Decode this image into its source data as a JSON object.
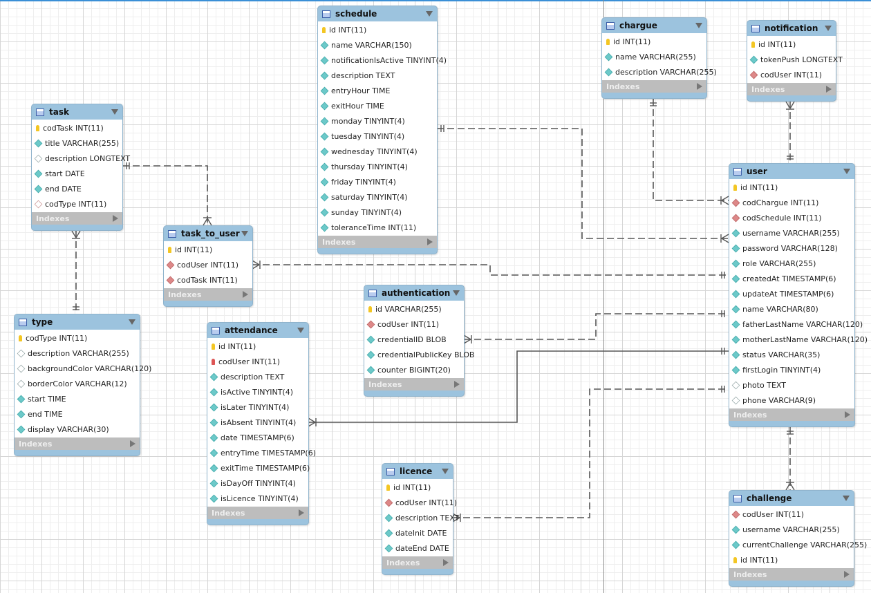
{
  "indexes_label": "Indexes",
  "colors": {
    "header": "#9cc3de",
    "primary_key": "#f3c623",
    "foreign_key": "#d88888",
    "not_null": "#6cc9c9"
  },
  "tables": [
    {
      "name": "schedule",
      "columns": [
        {
          "icon": "key",
          "text": "id INT(11)"
        },
        {
          "icon": "nn",
          "text": "name VARCHAR(150)"
        },
        {
          "icon": "nn",
          "text": "notificationIsActive TINYINT(4)"
        },
        {
          "icon": "nn",
          "text": "description TEXT"
        },
        {
          "icon": "nn",
          "text": "entryHour TIME"
        },
        {
          "icon": "nn",
          "text": "exitHour TIME"
        },
        {
          "icon": "nn",
          "text": "monday TINYINT(4)"
        },
        {
          "icon": "nn",
          "text": "tuesday TINYINT(4)"
        },
        {
          "icon": "nn",
          "text": "wednesday TINYINT(4)"
        },
        {
          "icon": "nn",
          "text": "thursday TINYINT(4)"
        },
        {
          "icon": "nn",
          "text": "friday TINYINT(4)"
        },
        {
          "icon": "nn",
          "text": "saturday TINYINT(4)"
        },
        {
          "icon": "nn",
          "text": "sunday TINYINT(4)"
        },
        {
          "icon": "nn",
          "text": "toleranceTime INT(11)"
        }
      ]
    },
    {
      "name": "task",
      "columns": [
        {
          "icon": "key",
          "text": "codTask INT(11)"
        },
        {
          "icon": "nn",
          "text": "title VARCHAR(255)"
        },
        {
          "icon": "null",
          "text": "description LONGTEXT"
        },
        {
          "icon": "nn",
          "text": "start DATE"
        },
        {
          "icon": "nn",
          "text": "end DATE"
        },
        {
          "icon": "fknull",
          "text": "codType INT(11)"
        }
      ]
    },
    {
      "name": "task_to_user",
      "columns": [
        {
          "icon": "key",
          "text": "id INT(11)"
        },
        {
          "icon": "fk",
          "text": "codUser INT(11)"
        },
        {
          "icon": "fk",
          "text": "codTask INT(11)"
        }
      ]
    },
    {
      "name": "type",
      "columns": [
        {
          "icon": "key",
          "text": "codType INT(11)"
        },
        {
          "icon": "null",
          "text": "description VARCHAR(255)"
        },
        {
          "icon": "null",
          "text": "backgroundColor VARCHAR(120)"
        },
        {
          "icon": "null",
          "text": "borderColor VARCHAR(12)"
        },
        {
          "icon": "nn",
          "text": "start TIME"
        },
        {
          "icon": "nn",
          "text": "end TIME"
        },
        {
          "icon": "nn",
          "text": "display VARCHAR(30)"
        }
      ]
    },
    {
      "name": "attendance",
      "columns": [
        {
          "icon": "key",
          "text": "id INT(11)"
        },
        {
          "icon": "fkkey",
          "text": "codUser INT(11)"
        },
        {
          "icon": "nn",
          "text": "description TEXT"
        },
        {
          "icon": "nn",
          "text": "isActive TINYINT(4)"
        },
        {
          "icon": "nn",
          "text": "isLater TINYINT(4)"
        },
        {
          "icon": "nn",
          "text": "isAbsent TINYINT(4)"
        },
        {
          "icon": "nn",
          "text": "date TIMESTAMP(6)"
        },
        {
          "icon": "nn",
          "text": "entryTime TIMESTAMP(6)"
        },
        {
          "icon": "nn",
          "text": "exitTime TIMESTAMP(6)"
        },
        {
          "icon": "nn",
          "text": "isDayOff TINYINT(4)"
        },
        {
          "icon": "nn",
          "text": "isLicence TINYINT(4)"
        }
      ]
    },
    {
      "name": "authentication",
      "columns": [
        {
          "icon": "key",
          "text": "id VARCHAR(255)"
        },
        {
          "icon": "fk",
          "text": "codUser INT(11)"
        },
        {
          "icon": "nn",
          "text": "credentialID BLOB"
        },
        {
          "icon": "nn",
          "text": "credentialPublicKey BLOB"
        },
        {
          "icon": "nn",
          "text": "counter BIGINT(20)"
        }
      ]
    },
    {
      "name": "licence",
      "columns": [
        {
          "icon": "key",
          "text": "id INT(11)"
        },
        {
          "icon": "fk",
          "text": "codUser INT(11)"
        },
        {
          "icon": "nn",
          "text": "description TEXT"
        },
        {
          "icon": "nn",
          "text": "dateInit DATE"
        },
        {
          "icon": "nn",
          "text": "dateEnd DATE"
        }
      ]
    },
    {
      "name": "chargue",
      "columns": [
        {
          "icon": "key",
          "text": "id INT(11)"
        },
        {
          "icon": "nn",
          "text": "name VARCHAR(255)"
        },
        {
          "icon": "nn",
          "text": "description VARCHAR(255)"
        }
      ]
    },
    {
      "name": "notification",
      "columns": [
        {
          "icon": "key",
          "text": "id INT(11)"
        },
        {
          "icon": "nn",
          "text": "tokenPush LONGTEXT"
        },
        {
          "icon": "fk",
          "text": "codUser INT(11)"
        }
      ]
    },
    {
      "name": "user",
      "columns": [
        {
          "icon": "key",
          "text": "id INT(11)"
        },
        {
          "icon": "fk",
          "text": "codChargue INT(11)"
        },
        {
          "icon": "fk",
          "text": "codSchedule INT(11)"
        },
        {
          "icon": "nn",
          "text": "username VARCHAR(255)"
        },
        {
          "icon": "nn",
          "text": "password VARCHAR(128)"
        },
        {
          "icon": "nn",
          "text": "role VARCHAR(255)"
        },
        {
          "icon": "nn",
          "text": "createdAt TIMESTAMP(6)"
        },
        {
          "icon": "nn",
          "text": "updateAt TIMESTAMP(6)"
        },
        {
          "icon": "nn",
          "text": "name VARCHAR(80)"
        },
        {
          "icon": "nn",
          "text": "fatherLastName VARCHAR(120)"
        },
        {
          "icon": "nn",
          "text": "motherLastName VARCHAR(120)"
        },
        {
          "icon": "nn",
          "text": "status VARCHAR(35)"
        },
        {
          "icon": "nn",
          "text": "firstLogin TINYINT(4)"
        },
        {
          "icon": "null",
          "text": "photo TEXT"
        },
        {
          "icon": "null",
          "text": "phone VARCHAR(9)"
        }
      ]
    },
    {
      "name": "challenge",
      "columns": [
        {
          "icon": "fk",
          "text": "codUser INT(11)"
        },
        {
          "icon": "nn",
          "text": "username VARCHAR(255)"
        },
        {
          "icon": "nn",
          "text": "currentChallenge VARCHAR(255)"
        },
        {
          "icon": "key",
          "text": "id INT(11)"
        }
      ]
    }
  ],
  "relationships": [
    {
      "from": "task",
      "to": "task_to_user",
      "type": "one-to-many",
      "identifying": false
    },
    {
      "from": "type",
      "to": "task",
      "type": "one-to-many",
      "identifying": false
    },
    {
      "from": "user",
      "to": "task_to_user",
      "type": "one-to-many",
      "identifying": false
    },
    {
      "from": "schedule",
      "to": "user",
      "type": "one-to-many",
      "identifying": false
    },
    {
      "from": "chargue",
      "to": "user",
      "type": "one-to-many",
      "identifying": false
    },
    {
      "from": "user",
      "to": "notification",
      "type": "one-to-many",
      "identifying": false
    },
    {
      "from": "user",
      "to": "authentication",
      "type": "one-to-many",
      "identifying": false
    },
    {
      "from": "user",
      "to": "attendance",
      "type": "one-to-many",
      "identifying": true
    },
    {
      "from": "user",
      "to": "licence",
      "type": "one-to-many",
      "identifying": false
    },
    {
      "from": "user",
      "to": "challenge",
      "type": "one-to-many",
      "identifying": false
    }
  ]
}
